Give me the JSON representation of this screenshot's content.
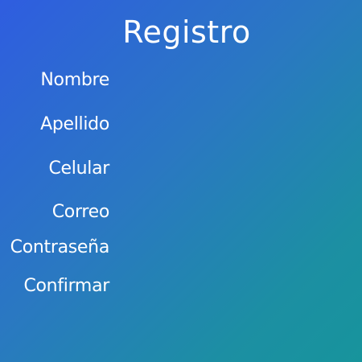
{
  "form": {
    "title": "Registro",
    "fields": [
      {
        "label": "Nombre",
        "value": ""
      },
      {
        "label": "Apellido",
        "value": ""
      },
      {
        "label": "Celular",
        "value": ""
      },
      {
        "label": "Correo",
        "value": ""
      },
      {
        "label": "Contraseña",
        "value": ""
      },
      {
        "label": "Confirmar",
        "value": ""
      }
    ]
  },
  "colors": {
    "gradient_start": "#2f5de0",
    "gradient_end": "#17949c",
    "text": "#ffffff"
  }
}
